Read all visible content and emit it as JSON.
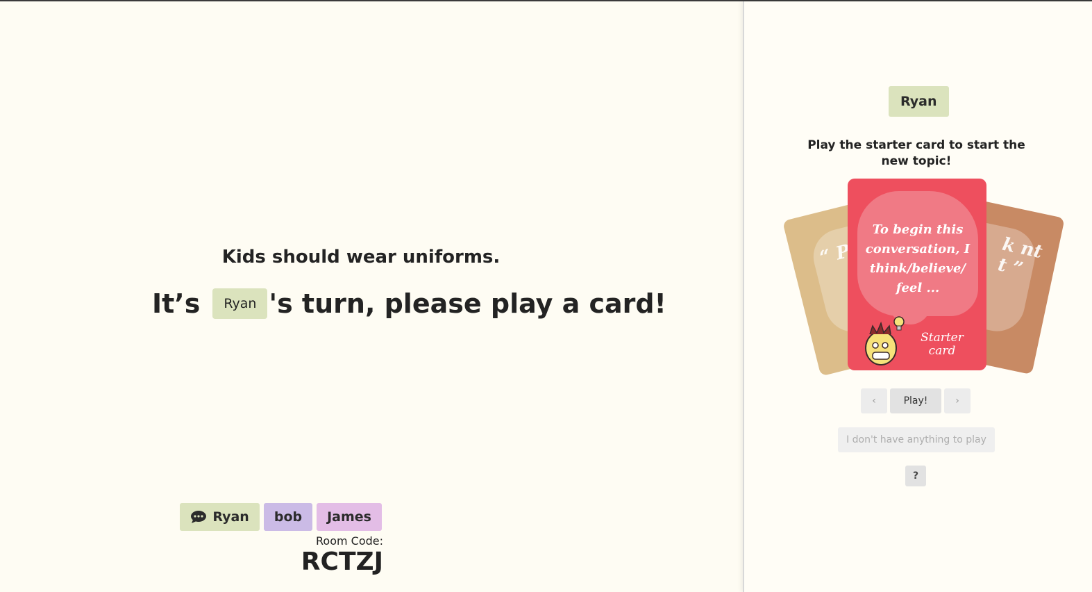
{
  "board": {
    "topic": "Kids should wear uniforms.",
    "turn_prefix": "It’s",
    "turn_player": "Ryan",
    "turn_suffix": "'s turn, please play a card!",
    "players": [
      {
        "name": "Ryan",
        "color": "#dbe3bd",
        "icon": "chat-bubble-icon"
      },
      {
        "name": "bob",
        "color": "#cbbbe6"
      },
      {
        "name": "James",
        "color": "#e3bde6"
      }
    ],
    "room_code_label": "Room Code:",
    "room_code": "RCTZJ"
  },
  "panel": {
    "current_player": "Ryan",
    "instruction": "Play the starter card to start the new topic!",
    "cards": {
      "front": {
        "text": "To begin this conversation, I think/believe/ feel ...",
        "label": "Starter card",
        "color": "#ee4f5e"
      },
      "left_partial_text": "“ Pl pi a",
      "right_partial_text": "k nt t ”"
    },
    "buttons": {
      "prev": "‹",
      "play": "Play!",
      "next": "›",
      "nothing": "I don't have anything to play",
      "help": "?"
    }
  },
  "colors": {
    "background": "#fefcf3",
    "accent_green": "#dbe3bd",
    "accent_purple": "#cbbbe6",
    "accent_pink": "#e3bde6",
    "card_red": "#ee4f5e"
  }
}
